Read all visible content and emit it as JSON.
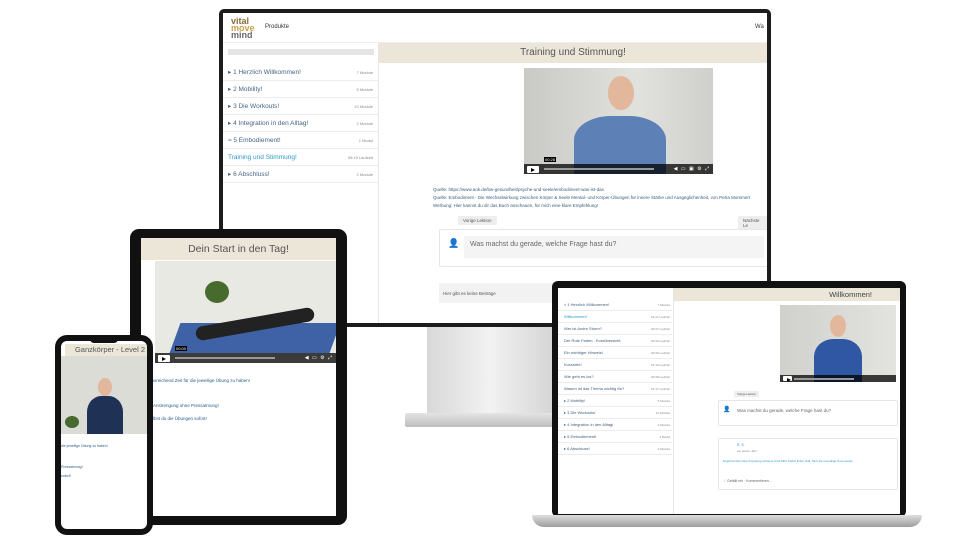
{
  "monitor": {
    "logo": [
      "vital",
      "move",
      "mind"
    ],
    "nav_products": "Produkte",
    "nav_right": "Wa",
    "sidebar": [
      {
        "label": "▸ 1 Herzlich Willkommen!",
        "count": "7 Module"
      },
      {
        "label": "▸ 2 Mobility!",
        "count": "5 Module"
      },
      {
        "label": "▸ 3 Die Workouts!",
        "count": "10 Module"
      },
      {
        "label": "▸ 4 Integration in den Alltag!",
        "count": "2 Module"
      },
      {
        "label": "≈ 5 Embodiement!",
        "count": "1 Modul"
      },
      {
        "label": "Training und Stimmung!",
        "count": "05:19 Laufzeit",
        "active": true
      },
      {
        "label": "▸ 6 Abschluss!",
        "count": "2 Module"
      }
    ],
    "title": "Training und Stimmung!",
    "video_time": "00:28",
    "sources": [
      "Quelle: https://www.aok.de/bw-gesundheit/psyche-und-seele/embodiment-was-ist-das",
      "Quelle: Embodiment - Die Wechselwirkung zwischen Körper & Seele Mental- und Körper-Übungen für innere Stärke und Ausgeglichenheit, von Petra Mommert",
      "Werbung: Hier kannst du dir das Buch anschauen, für mich eine klare Empfehlung!"
    ],
    "prev_button": "Vorige Lektion",
    "next_button": "Nächste Le",
    "comment_placeholder": "Was machst du gerade, welche Frage hast du?",
    "no_posts": "Hier gibt es keine Beiträge"
  },
  "tablet": {
    "title": "Dein Start in den Tag!",
    "video_time": "00:00",
    "lines": [
      "ausreichend Zeit für die jeweilige Übung zu haben!",
      "Anstrengung ohne Pressatmung!",
      "lbst du die Übungen sofort!"
    ]
  },
  "phone": {
    "title": "Ganzkörper - Level 2",
    "lines": [
      "die jeweilige Übung zu haben!",
      "Pressatmung!",
      "sofort!"
    ]
  },
  "laptop": {
    "title": "Willkommen!",
    "sidebar": [
      {
        "label": "≈ 1 Herzlich Willkommen!",
        "count": "7 Module"
      },
      {
        "label": "Willkommen!",
        "count": "01:21 Laufzeit",
        "active": true
      },
      {
        "label": "Wer ist Andre Sturm?",
        "count": "00:37 Laufzeit"
      },
      {
        "label": "Der Rote Faden - Kursübersicht",
        "count": "00:33 Laufzeit"
      },
      {
        "label": "Ein wichtiger Hinweis!",
        "count": "00:35 Laufzeit"
      },
      {
        "label": "Kurzziele!",
        "count": "01:42 Laufzeit"
      },
      {
        "label": "Wie geht es los?",
        "count": "00:38 Laufzeit"
      },
      {
        "label": "Warum ist das Thema wichtig für?",
        "count": "01:47 Laufzeit"
      },
      {
        "label": "▸ 2 Mobility!",
        "count": "5 Module"
      },
      {
        "label": "▸ 3 Die Workouts!",
        "count": "10 Module"
      },
      {
        "label": "▸ 4 Integration in den Alltag!",
        "count": "2 Module"
      },
      {
        "label": "▸ 5 Embodiement!",
        "count": "1 Modul"
      },
      {
        "label": "▸ 6 Abschluss!",
        "count": "2 Module"
      }
    ],
    "prev_button": "Vorige Lektion",
    "comment_placeholder": "Was machst du gerade, welche Frage hast du?",
    "post_author": "R. S.",
    "post_meta": "vor einem Jahr",
    "post_text": "Ergebnis bist ohne Kopplung schwere Kind Mild. Dabei lieber Hall, Sich die einmalige Kommentar.",
    "post_actions": "♡ Gefällt mir · Kommentieren..."
  }
}
